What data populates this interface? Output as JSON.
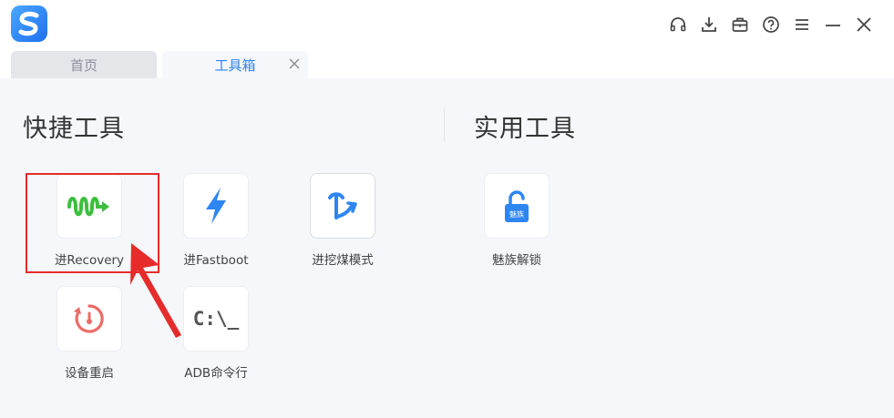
{
  "window": {
    "controls": [
      {
        "name": "headset-icon"
      },
      {
        "name": "download-icon"
      },
      {
        "name": "toolbox-icon"
      },
      {
        "name": "help-icon"
      },
      {
        "name": "menu-icon"
      },
      {
        "name": "minimize-icon"
      },
      {
        "name": "close-icon"
      }
    ]
  },
  "tabs": {
    "home": "首页",
    "toolbox": "工具箱"
  },
  "sections": {
    "quick": "快捷工具",
    "practical": "实用工具"
  },
  "tools": {
    "recovery": "进Recovery",
    "fastboot": "进Fastboot",
    "mining": "进挖煤模式",
    "meizu_unlock": "魅族解锁",
    "meizu_badge": "魅族",
    "reboot": "设备重启",
    "adb": "ADB命令行",
    "adb_glyph": "C:\\_"
  },
  "colors": {
    "accent": "#2e86f3",
    "highlight": "#e62b2b",
    "recovery_green": "#3cbf3c",
    "reboot_red": "#ec6b66"
  }
}
